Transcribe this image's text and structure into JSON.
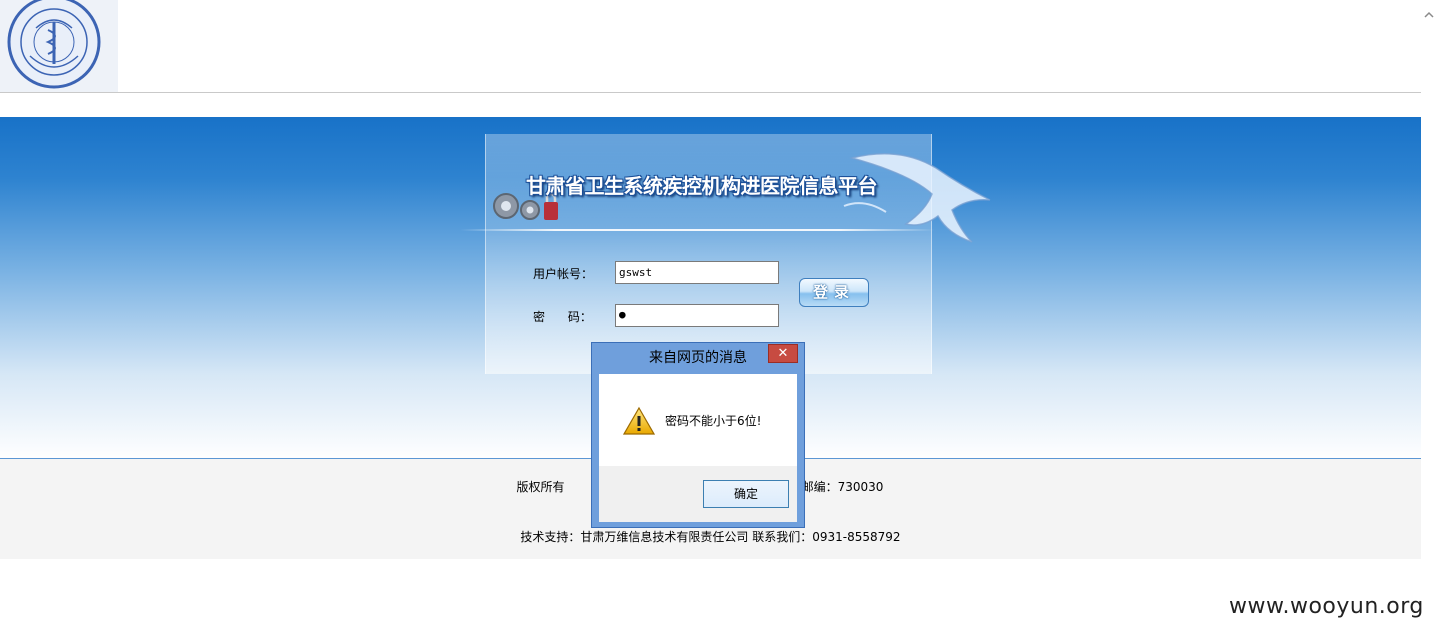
{
  "header": {
    "logo_name": "gansu-health-department-seal",
    "logo_text": "甘肃省卫生厅 GANSU PROVINCIAL HEALTH DEPARTMENT"
  },
  "banner": {
    "title": "甘肃省卫生系统疾控机构进医院信息平台"
  },
  "login": {
    "username_label": "用户帐号：",
    "username_value": "gswst",
    "password_label": "密      码：",
    "password_value": "●",
    "submit_label": "登录"
  },
  "footer": {
    "copyright_visible_left": "版权所有",
    "copyright_visible_right": "邮编：730030",
    "tech_support": "技术支持：甘肃万维信息技术有限责任公司 联系我们：0931-8558792"
  },
  "dialog": {
    "title": "来自网页的消息",
    "close_label": "✕",
    "message": "密码不能小于6位!",
    "ok_label": "确定",
    "icon": "warning-icon"
  },
  "watermark": "www.wooyun.org",
  "colors": {
    "banner_top": "#1872c8",
    "dialog_frame": "#6f9fdc",
    "close_button": "#c74b41",
    "footer_bg": "#f4f4f4"
  }
}
